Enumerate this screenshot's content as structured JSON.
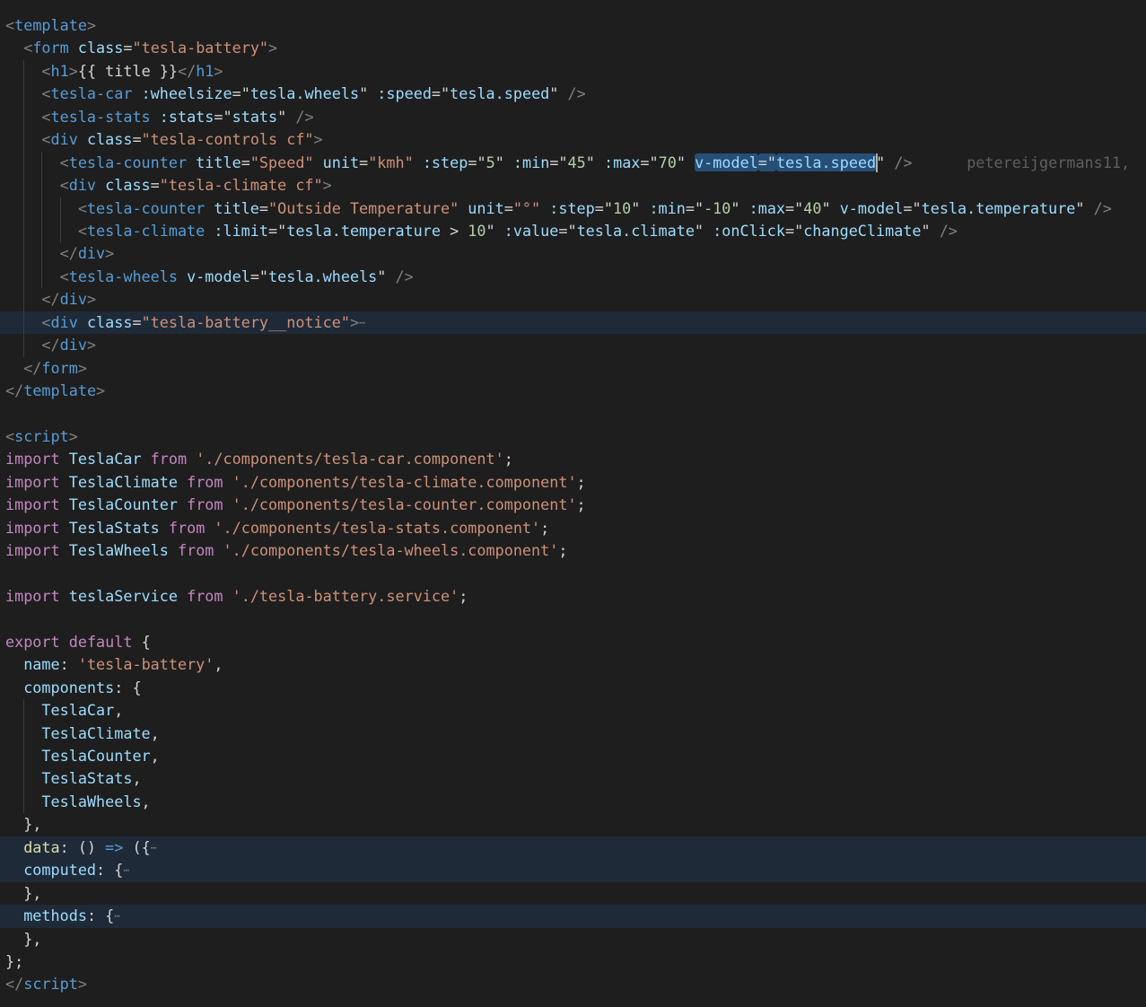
{
  "lines": [
    {
      "indent": 0,
      "tokens": [
        [
          "p",
          "<"
        ],
        [
          "t",
          "template"
        ],
        [
          "p",
          ">"
        ]
      ]
    },
    {
      "indent": 1,
      "tokens": [
        [
          "p",
          "<"
        ],
        [
          "t",
          "form"
        ],
        [
          "q",
          " "
        ],
        [
          "a",
          "class"
        ],
        [
          "q",
          "="
        ],
        [
          "s",
          "\"tesla-battery\""
        ],
        [
          "p",
          ">"
        ]
      ]
    },
    {
      "indent": 2,
      "tokens": [
        [
          "p",
          "<"
        ],
        [
          "t",
          "h1"
        ],
        [
          "p",
          ">"
        ],
        [
          "q",
          "{{ title }}"
        ],
        [
          "p",
          "</"
        ],
        [
          "t",
          "h1"
        ],
        [
          "p",
          ">"
        ]
      ]
    },
    {
      "indent": 2,
      "tokens": [
        [
          "p",
          "<"
        ],
        [
          "t",
          "tesla-car"
        ],
        [
          "q",
          " "
        ],
        [
          "a",
          ":wheelsize"
        ],
        [
          "q",
          "=\""
        ],
        [
          "v",
          "tesla.wheels"
        ],
        [
          "q",
          "\" "
        ],
        [
          "a",
          ":speed"
        ],
        [
          "q",
          "=\""
        ],
        [
          "v",
          "tesla.speed"
        ],
        [
          "q",
          "\" "
        ],
        [
          "p",
          "/>"
        ]
      ]
    },
    {
      "indent": 2,
      "tokens": [
        [
          "p",
          "<"
        ],
        [
          "t",
          "tesla-stats"
        ],
        [
          "q",
          " "
        ],
        [
          "a",
          ":stats"
        ],
        [
          "q",
          "=\""
        ],
        [
          "v",
          "stats"
        ],
        [
          "q",
          "\" "
        ],
        [
          "p",
          "/>"
        ]
      ]
    },
    {
      "indent": 2,
      "tokens": [
        [
          "p",
          "<"
        ],
        [
          "t",
          "div"
        ],
        [
          "q",
          " "
        ],
        [
          "a",
          "class"
        ],
        [
          "q",
          "="
        ],
        [
          "s",
          "\"tesla-controls cf\""
        ],
        [
          "p",
          ">"
        ]
      ]
    },
    {
      "indent": 3,
      "tokens": [
        [
          "p",
          "<"
        ],
        [
          "t",
          "tesla-counter"
        ],
        [
          "q",
          " "
        ],
        [
          "a",
          "title"
        ],
        [
          "q",
          "="
        ],
        [
          "s",
          "\"Speed\""
        ],
        [
          "q",
          " "
        ],
        [
          "a",
          "unit"
        ],
        [
          "q",
          "="
        ],
        [
          "s",
          "\"kmh\""
        ],
        [
          "q",
          " "
        ],
        [
          "a",
          ":step"
        ],
        [
          "q",
          "=\""
        ],
        [
          "n",
          "5"
        ],
        [
          "q",
          "\" "
        ],
        [
          "a",
          ":min"
        ],
        [
          "q",
          "=\""
        ],
        [
          "n",
          "45"
        ],
        [
          "q",
          "\" "
        ],
        [
          "a",
          ":max"
        ],
        [
          "q",
          "=\""
        ],
        [
          "n",
          "70"
        ],
        [
          "q",
          "\" "
        ],
        [
          "a",
          "v-model",
          "sel"
        ],
        [
          "q",
          "=\"",
          "sel"
        ],
        [
          "v",
          "tesla.speed",
          "sel"
        ],
        [
          "cursor",
          ""
        ],
        [
          "q",
          "\" "
        ],
        [
          "p",
          "/>"
        ]
      ],
      "blame": "petereijgermans11,"
    },
    {
      "indent": 3,
      "tokens": [
        [
          "p",
          "<"
        ],
        [
          "t",
          "div"
        ],
        [
          "q",
          " "
        ],
        [
          "a",
          "class"
        ],
        [
          "q",
          "="
        ],
        [
          "s",
          "\"tesla-climate cf\""
        ],
        [
          "p",
          ">"
        ]
      ]
    },
    {
      "indent": 4,
      "tokens": [
        [
          "p",
          "<"
        ],
        [
          "t",
          "tesla-counter"
        ],
        [
          "q",
          " "
        ],
        [
          "a",
          "title"
        ],
        [
          "q",
          "="
        ],
        [
          "s",
          "\"Outside Temperature\""
        ],
        [
          "q",
          " "
        ],
        [
          "a",
          "unit"
        ],
        [
          "q",
          "="
        ],
        [
          "s",
          "\"°\""
        ],
        [
          "q",
          " "
        ],
        [
          "a",
          ":step"
        ],
        [
          "q",
          "=\""
        ],
        [
          "n",
          "10"
        ],
        [
          "q",
          "\" "
        ],
        [
          "a",
          ":min"
        ],
        [
          "q",
          "=\""
        ],
        [
          "n",
          "-10"
        ],
        [
          "q",
          "\" "
        ],
        [
          "a",
          ":max"
        ],
        [
          "q",
          "=\""
        ],
        [
          "n",
          "40"
        ],
        [
          "q",
          "\" "
        ],
        [
          "a",
          "v-model"
        ],
        [
          "q",
          "=\""
        ],
        [
          "v",
          "tesla.temperature"
        ],
        [
          "q",
          "\" "
        ],
        [
          "p",
          "/>"
        ]
      ]
    },
    {
      "indent": 4,
      "tokens": [
        [
          "p",
          "<"
        ],
        [
          "t",
          "tesla-climate"
        ],
        [
          "q",
          " "
        ],
        [
          "a",
          ":limit"
        ],
        [
          "q",
          "=\""
        ],
        [
          "v",
          "tesla.temperature"
        ],
        [
          "q",
          " > "
        ],
        [
          "n",
          "10"
        ],
        [
          "q",
          "\" "
        ],
        [
          "a",
          ":value"
        ],
        [
          "q",
          "=\""
        ],
        [
          "v",
          "tesla.climate"
        ],
        [
          "q",
          "\" "
        ],
        [
          "a",
          ":onClick"
        ],
        [
          "q",
          "=\""
        ],
        [
          "v",
          "changeClimate"
        ],
        [
          "q",
          "\" "
        ],
        [
          "p",
          "/>"
        ]
      ]
    },
    {
      "indent": 3,
      "tokens": [
        [
          "p",
          "</"
        ],
        [
          "t",
          "div"
        ],
        [
          "p",
          ">"
        ]
      ]
    },
    {
      "indent": 3,
      "tokens": [
        [
          "p",
          "<"
        ],
        [
          "t",
          "tesla-wheels"
        ],
        [
          "q",
          " "
        ],
        [
          "a",
          "v-model"
        ],
        [
          "q",
          "=\""
        ],
        [
          "v",
          "tesla.wheels"
        ],
        [
          "q",
          "\" "
        ],
        [
          "p",
          "/>"
        ]
      ]
    },
    {
      "indent": 2,
      "tokens": [
        [
          "p",
          "</"
        ],
        [
          "t",
          "div"
        ],
        [
          "p",
          ">"
        ]
      ]
    },
    {
      "indent": 2,
      "hl": true,
      "tokens": [
        [
          "p",
          "<"
        ],
        [
          "t",
          "div"
        ],
        [
          "q",
          " "
        ],
        [
          "a",
          "class"
        ],
        [
          "q",
          "="
        ],
        [
          "s",
          "\"tesla-battery__notice\""
        ],
        [
          "p",
          ">"
        ],
        [
          "e",
          "⋯"
        ]
      ]
    },
    {
      "indent": 2,
      "tokens": [
        [
          "p",
          "</"
        ],
        [
          "t",
          "div"
        ],
        [
          "p",
          ">"
        ]
      ]
    },
    {
      "indent": 1,
      "tokens": [
        [
          "p",
          "</"
        ],
        [
          "t",
          "form"
        ],
        [
          "p",
          ">"
        ]
      ]
    },
    {
      "indent": 0,
      "tokens": [
        [
          "p",
          "</"
        ],
        [
          "t",
          "template"
        ],
        [
          "p",
          ">"
        ]
      ]
    },
    {
      "indent": 0,
      "tokens": []
    },
    {
      "indent": 0,
      "tokens": [
        [
          "p",
          "<"
        ],
        [
          "t",
          "script"
        ],
        [
          "p",
          ">"
        ]
      ]
    },
    {
      "indent": 0,
      "tokens": [
        [
          "k",
          "import"
        ],
        [
          "q",
          " "
        ],
        [
          "i",
          "TeslaCar"
        ],
        [
          "q",
          " "
        ],
        [
          "k",
          "from"
        ],
        [
          "q",
          " "
        ],
        [
          "s",
          "'./components/tesla-car.component'"
        ],
        [
          "q",
          ";"
        ]
      ]
    },
    {
      "indent": 0,
      "tokens": [
        [
          "k",
          "import"
        ],
        [
          "q",
          " "
        ],
        [
          "i",
          "TeslaClimate"
        ],
        [
          "q",
          " "
        ],
        [
          "k",
          "from"
        ],
        [
          "q",
          " "
        ],
        [
          "s",
          "'./components/tesla-climate.component'"
        ],
        [
          "q",
          ";"
        ]
      ]
    },
    {
      "indent": 0,
      "tokens": [
        [
          "k",
          "import"
        ],
        [
          "q",
          " "
        ],
        [
          "i",
          "TeslaCounter"
        ],
        [
          "q",
          " "
        ],
        [
          "k",
          "from"
        ],
        [
          "q",
          " "
        ],
        [
          "s",
          "'./components/tesla-counter.component'"
        ],
        [
          "q",
          ";"
        ]
      ]
    },
    {
      "indent": 0,
      "tokens": [
        [
          "k",
          "import"
        ],
        [
          "q",
          " "
        ],
        [
          "i",
          "TeslaStats"
        ],
        [
          "q",
          " "
        ],
        [
          "k",
          "from"
        ],
        [
          "q",
          " "
        ],
        [
          "s",
          "'./components/tesla-stats.component'"
        ],
        [
          "q",
          ";"
        ]
      ]
    },
    {
      "indent": 0,
      "tokens": [
        [
          "k",
          "import"
        ],
        [
          "q",
          " "
        ],
        [
          "i",
          "TeslaWheels"
        ],
        [
          "q",
          " "
        ],
        [
          "k",
          "from"
        ],
        [
          "q",
          " "
        ],
        [
          "s",
          "'./components/tesla-wheels.component'"
        ],
        [
          "q",
          ";"
        ]
      ]
    },
    {
      "indent": 0,
      "tokens": []
    },
    {
      "indent": 0,
      "tokens": [
        [
          "k",
          "import"
        ],
        [
          "q",
          " "
        ],
        [
          "i",
          "teslaService"
        ],
        [
          "q",
          " "
        ],
        [
          "k",
          "from"
        ],
        [
          "q",
          " "
        ],
        [
          "s",
          "'./tesla-battery.service'"
        ],
        [
          "q",
          ";"
        ]
      ]
    },
    {
      "indent": 0,
      "tokens": []
    },
    {
      "indent": 0,
      "tokens": [
        [
          "k",
          "export"
        ],
        [
          "q",
          " "
        ],
        [
          "k",
          "default"
        ],
        [
          "q",
          " {"
        ]
      ]
    },
    {
      "indent": 1,
      "tokens": [
        [
          "i",
          "name"
        ],
        [
          "q",
          ": "
        ],
        [
          "s",
          "'tesla-battery'"
        ],
        [
          "q",
          ","
        ]
      ]
    },
    {
      "indent": 1,
      "tokens": [
        [
          "i",
          "components"
        ],
        [
          "q",
          ": {"
        ]
      ]
    },
    {
      "indent": 2,
      "tokens": [
        [
          "i",
          "TeslaCar"
        ],
        [
          "q",
          ","
        ]
      ]
    },
    {
      "indent": 2,
      "tokens": [
        [
          "i",
          "TeslaClimate"
        ],
        [
          "q",
          ","
        ]
      ]
    },
    {
      "indent": 2,
      "tokens": [
        [
          "i",
          "TeslaCounter"
        ],
        [
          "q",
          ","
        ]
      ]
    },
    {
      "indent": 2,
      "tokens": [
        [
          "i",
          "TeslaStats"
        ],
        [
          "q",
          ","
        ]
      ]
    },
    {
      "indent": 2,
      "tokens": [
        [
          "i",
          "TeslaWheels"
        ],
        [
          "q",
          ","
        ]
      ]
    },
    {
      "indent": 1,
      "tokens": [
        [
          "q",
          "},"
        ]
      ]
    },
    {
      "indent": 1,
      "hl": true,
      "tokens": [
        [
          "f",
          "data"
        ],
        [
          "q",
          ": () "
        ],
        [
          "b",
          "=>"
        ],
        [
          "q",
          " ({"
        ],
        [
          "e",
          "⋯"
        ]
      ]
    },
    {
      "indent": 1,
      "hl": true,
      "tokens": [
        [
          "i",
          "computed"
        ],
        [
          "q",
          ": {"
        ],
        [
          "e",
          "⋯"
        ]
      ]
    },
    {
      "indent": 1,
      "tokens": [
        [
          "q",
          "},"
        ]
      ]
    },
    {
      "indent": 1,
      "hl": true,
      "tokens": [
        [
          "i",
          "methods"
        ],
        [
          "q",
          ": {"
        ],
        [
          "e",
          "⋯"
        ]
      ]
    },
    {
      "indent": 1,
      "tokens": [
        [
          "q",
          "},"
        ]
      ]
    },
    {
      "indent": 0,
      "tokens": [
        [
          "q",
          "};"
        ]
      ]
    },
    {
      "indent": 0,
      "tokens": [
        [
          "p",
          "</"
        ],
        [
          "t",
          "script"
        ],
        [
          "p",
          ">"
        ]
      ]
    }
  ]
}
